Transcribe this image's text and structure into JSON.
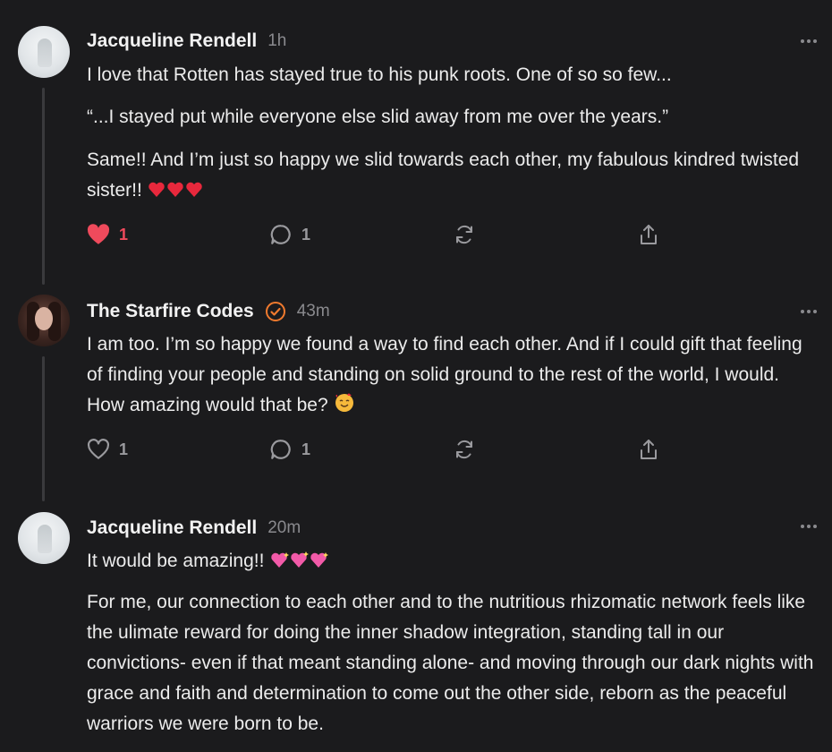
{
  "posts": [
    {
      "author": "Jacqueline Rendell",
      "time": "1h",
      "paragraphs": [
        "I love that Rotten has stayed true to his punk roots. One of so so few...",
        "“...I stayed put while everyone else slid away from me over the years.”",
        "Same!! And I’m just so happy we slid towards each other, my fabulous kindred twisted sister!!"
      ],
      "like_count": "1",
      "reply_count": "1",
      "liked": true,
      "accent_color": "#ef4a5c"
    },
    {
      "author": "The Starfire Codes",
      "verified": true,
      "time": "43m",
      "paragraphs": [
        "I am too. I’m so happy we found a way to find each other. And if I could gift that feeling of finding your people and standing on solid ground to the rest of the world, I would. How amazing would that be?"
      ],
      "like_count": "1",
      "reply_count": "1",
      "liked": false,
      "verified_color": "#f07a2e"
    },
    {
      "author": "Jacqueline Rendell",
      "time": "20m",
      "paragraphs": [
        "It would be amazing!!",
        "For me, our connection to each other and to the nutritious rhizomatic network feels like the ulimate reward for doing the inner shadow integration, standing tall in our convictions- even if that meant standing alone- and moving through our dark nights with grace and faith and determination to come out the other side, reborn as the peaceful warriors we were born to be."
      ]
    }
  ],
  "icons": [
    "more-icon",
    "heart-icon",
    "reply-icon",
    "repost-icon",
    "share-icon",
    "verified-icon"
  ]
}
